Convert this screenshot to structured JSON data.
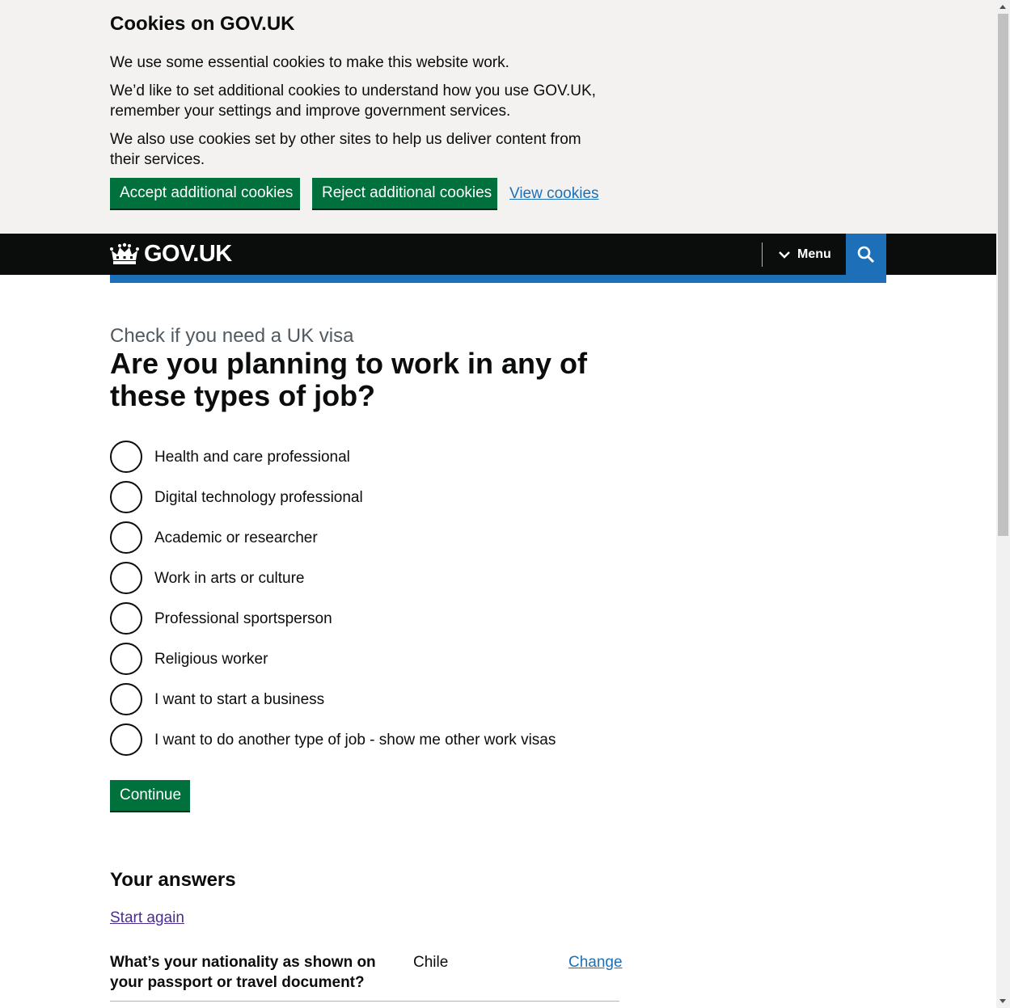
{
  "cookie_banner": {
    "title": "Cookies on GOV.UK",
    "p1": "We use some essential cookies to make this website work.",
    "p2": "We’d like to set additional cookies to understand how you use GOV.UK, remember your settings and improve government services.",
    "p3": "We also use cookies set by other sites to help us deliver content from their services.",
    "accept_label": "Accept additional cookies",
    "reject_label": "Reject additional cookies",
    "view_label": "View cookies"
  },
  "header": {
    "logo_text": "GOV.UK",
    "menu_label": "Menu",
    "icons": {
      "logo": "crown-icon",
      "menu": "chevron-down-icon",
      "search": "search-icon"
    }
  },
  "question": {
    "caption": "Check if you need a UK visa",
    "title": "Are you planning to work in any of these types of job?",
    "options": [
      "Health and care professional",
      "Digital technology professional",
      "Academic or researcher",
      "Work in arts or culture",
      "Professional sportsperson",
      "Religious worker",
      "I want to start a business",
      "I want to do another type of job - show me other work visas"
    ],
    "continue_label": "Continue"
  },
  "answers": {
    "title": "Your answers",
    "start_again": "Start again",
    "rows": [
      {
        "key": "What’s your nationality as shown on your passport or travel document?",
        "value": "Chile",
        "action": "Change"
      }
    ]
  },
  "colors": {
    "banner_bg": "#f3f2f1",
    "button_green": "#00703c",
    "header_black": "#0b0c0c",
    "brand_blue": "#1d70b8",
    "link_visited": "#4c2c92",
    "caption_grey": "#505a5f"
  }
}
